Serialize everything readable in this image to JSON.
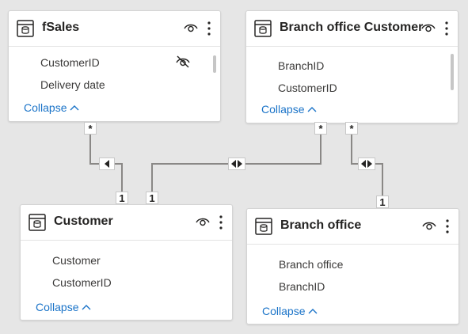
{
  "tables": [
    {
      "id": "fsales",
      "title": "fSales",
      "fields": [
        "CustomerID",
        "Delivery date"
      ],
      "collapse_label": "Collapse"
    },
    {
      "id": "branch-office-customer",
      "title": "Branch office Customer",
      "fields": [
        "BranchID",
        "CustomerID"
      ],
      "collapse_label": "Collapse"
    },
    {
      "id": "customer",
      "title": "Customer",
      "fields": [
        "Customer",
        "CustomerID"
      ],
      "collapse_label": "Collapse"
    },
    {
      "id": "branch-office",
      "title": "Branch office",
      "fields": [
        "Branch office",
        "BranchID"
      ],
      "collapse_label": "Collapse"
    }
  ],
  "relationships": [
    {
      "from": "fSales",
      "to": "Customer",
      "from_cardinality": "*",
      "to_cardinality": "1",
      "cross_filter": "single"
    },
    {
      "from": "Branch office Customer",
      "to": "Customer",
      "from_cardinality": "*",
      "to_cardinality": "1",
      "cross_filter": "both"
    },
    {
      "from": "Branch office Customer",
      "to": "Branch office",
      "from_cardinality": "*",
      "to_cardinality": "1",
      "cross_filter": "both"
    }
  ],
  "colors": {
    "canvas": "#e6e6e6",
    "card": "#ffffff",
    "link": "#1a73c8",
    "line": "#8a8886"
  },
  "icons": {
    "table": "table-icon",
    "visibility": "eye-icon",
    "more": "more-options-icon",
    "hidden_field": "eye-slash-icon",
    "expand": "chevron-up-icon"
  }
}
